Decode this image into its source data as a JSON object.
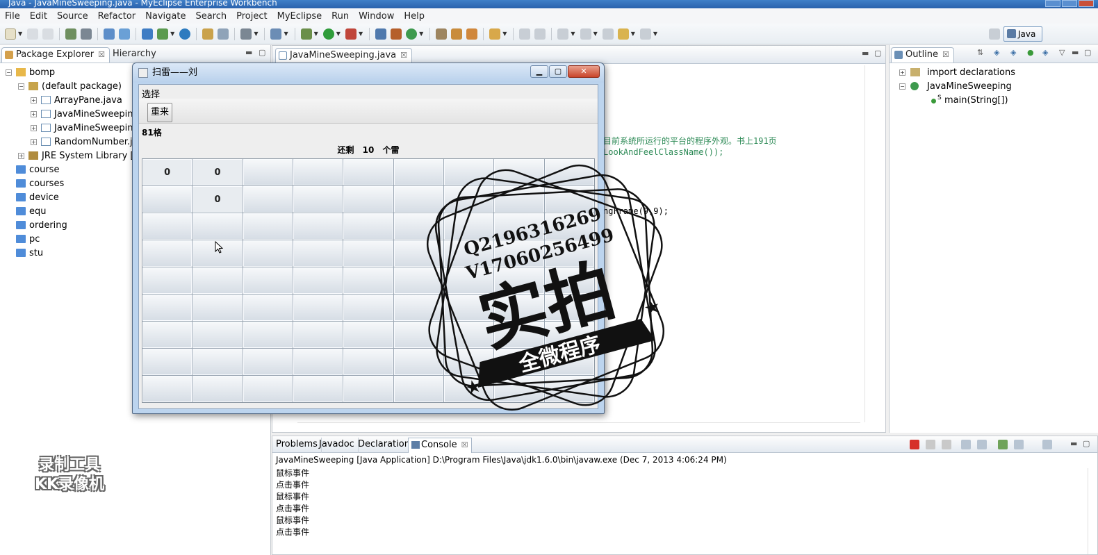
{
  "window": {
    "title": "Java - JavaMineSweeping.java - MyEclipse Enterprise Workbench"
  },
  "menubar": [
    "File",
    "Edit",
    "Source",
    "Refactor",
    "Navigate",
    "Search",
    "Project",
    "MyEclipse",
    "Run",
    "Window",
    "Help"
  ],
  "perspective": {
    "label": "Java"
  },
  "package_explorer": {
    "tabs": [
      "Package Explorer",
      "Hierarchy"
    ],
    "tree": [
      {
        "label": "bomp",
        "level": 0,
        "type": "project",
        "expander": "−"
      },
      {
        "label": "(default package)",
        "level": 1,
        "type": "package",
        "expander": "−"
      },
      {
        "label": "ArrayPane.java",
        "level": 2,
        "type": "java",
        "expander": "+"
      },
      {
        "label": "JavaMineSweeping",
        "level": 2,
        "type": "java",
        "expander": "+"
      },
      {
        "label": "JavaMineSweeping",
        "level": 2,
        "type": "java",
        "expander": "+"
      },
      {
        "label": "RandomNumber.ja",
        "level": 2,
        "type": "java",
        "expander": "+"
      },
      {
        "label": "JRE System Library [jdl",
        "level": 1,
        "type": "library",
        "expander": "+"
      },
      {
        "label": "course",
        "level": 0,
        "type": "folder",
        "expander": ""
      },
      {
        "label": "courses",
        "level": 0,
        "type": "folder",
        "expander": ""
      },
      {
        "label": "device",
        "level": 0,
        "type": "folder",
        "expander": ""
      },
      {
        "label": "equ",
        "level": 0,
        "type": "folder",
        "expander": ""
      },
      {
        "label": "ordering",
        "level": 0,
        "type": "folder",
        "expander": ""
      },
      {
        "label": "pc",
        "level": 0,
        "type": "folder",
        "expander": ""
      },
      {
        "label": "stu",
        "level": 0,
        "type": "folder",
        "expander": ""
      }
    ]
  },
  "editor": {
    "tab": "JavaMineSweeping.java",
    "code_fragments": [
      "目前系统所运行的平台的程序外观。书上191页",
      "LookAndFeelClassName());",
      "ngFrame(9,9);"
    ]
  },
  "outline": {
    "tab": "Outline",
    "items": [
      {
        "label": "import declarations",
        "level": 0
      },
      {
        "label": "JavaMineSweeping",
        "level": 0
      },
      {
        "label": "main(String[])",
        "level": 1
      }
    ]
  },
  "console": {
    "tabs": [
      "Problems",
      "Javadoc",
      "Declaration",
      "Console"
    ],
    "header": "JavaMineSweeping [Java Application] D:\\Program Files\\Java\\jdk1.6.0\\bin\\javaw.exe (Dec 7, 2013 4:06:24 PM)",
    "lines": [
      "鼠标事件",
      "点击事件",
      "鼠标事件",
      "点击事件",
      "鼠标事件",
      "点击事件"
    ]
  },
  "minesweeper": {
    "title": "扫雷——刘",
    "menu": "选择",
    "restart": "重来",
    "cells_label": "81格",
    "remain_prefix": "还剩",
    "remain_count": "10",
    "remain_suffix": "个雷",
    "grid": [
      [
        "0",
        "0",
        "",
        "",
        "",
        "",
        "",
        "",
        ""
      ],
      [
        "",
        "0",
        "",
        "",
        "",
        "",
        "",
        "",
        ""
      ],
      [
        "",
        "",
        "",
        "",
        "",
        "",
        "",
        "",
        ""
      ],
      [
        "",
        "",
        "",
        "",
        "",
        "",
        "",
        "",
        ""
      ],
      [
        "",
        "",
        "",
        "",
        "",
        "",
        "",
        "",
        ""
      ],
      [
        "",
        "",
        "",
        "",
        "",
        "",
        "",
        "",
        ""
      ],
      [
        "",
        "",
        "",
        "",
        "",
        "",
        "",
        "",
        ""
      ],
      [
        "",
        "",
        "",
        "",
        "",
        "",
        "",
        "",
        ""
      ],
      [
        "",
        "",
        "",
        "",
        "",
        "",
        "",
        "",
        ""
      ]
    ]
  },
  "watermark": {
    "line1": "Q2196316269",
    "line2": "V17060256499",
    "big": "实拍",
    "banner": "全微程序",
    "recorder_line1": "录制工具",
    "recorder_line2": "KK录像机"
  }
}
